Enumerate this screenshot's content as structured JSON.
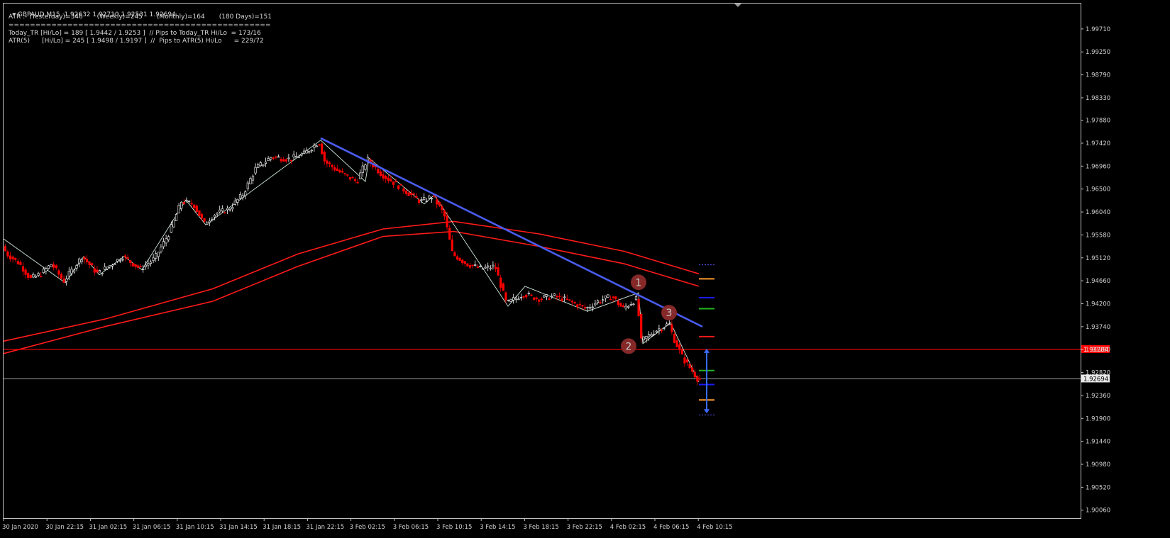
{
  "window": {
    "symbol_line": "GBPAUD,M15  1.92632 1.92710 1.92531 1.92694"
  },
  "indicator_text": {
    "atr_line": "ATR :- (Yesterday)=346       (Weekly)=245       (Monthly)=164       (180 Days)=151",
    "separator": "=================================================",
    "today_tr_line": "Today_TR [Hi/Lo] = 189 [ 1.9442 / 1.9253 ]  // Pips to Today_TR Hi/Lo  = 173/16",
    "atr5_line": "ATR(5)      [Hi/Lo] = 245 [ 1.9498 / 1.9197 ]  //  Pips to ATR(5) Hi/Lo      = 229/72"
  },
  "colors": {
    "background": "#000000",
    "axis": "#c0c0c0",
    "bull_candle": "#ffffff",
    "bear_candle": "#ff0000",
    "moving_average": "#ff1a1a",
    "trendline": "#4a5cf0",
    "support_line": "#ff0000",
    "current_price_line": "#a0a0a0",
    "zigzag": "#cfe8d8",
    "marker": "#8b2a2a"
  },
  "chart_data": {
    "type": "candlestick",
    "symbol": "GBPAUD",
    "timeframe": "M15",
    "y_ticks": [
      "1.99710",
      "1.99250",
      "1.98790",
      "1.98330",
      "1.97880",
      "1.97420",
      "1.96960",
      "1.96500",
      "1.96040",
      "1.95580",
      "1.95120",
      "1.94660",
      "1.94200",
      "1.93740",
      "1.93280",
      "1.92820",
      "1.92360",
      "1.91900",
      "1.91440",
      "1.90980",
      "1.90520",
      "1.90060"
    ],
    "ylim": [
      1.899,
      2.0022
    ],
    "x_ticks": [
      "30 Jan 2020",
      "30 Jan 22:15",
      "31 Jan 02:15",
      "31 Jan 06:15",
      "31 Jan 10:15",
      "31 Jan 14:15",
      "31 Jan 18:15",
      "31 Jan 22:15",
      "3 Feb 02:15",
      "3 Feb 06:15",
      "3 Feb 10:15",
      "3 Feb 14:15",
      "3 Feb 18:15",
      "3 Feb 22:15",
      "4 Feb 02:15",
      "4 Feb 06:15",
      "4 Feb 10:15"
    ],
    "price_path": [
      [
        0,
        1.955
      ],
      [
        12,
        1.952
      ],
      [
        30,
        1.95
      ],
      [
        45,
        1.947
      ],
      [
        60,
        1.948
      ],
      [
        75,
        1.95
      ],
      [
        92,
        1.9465
      ],
      [
        100,
        1.948
      ],
      [
        118,
        1.9515
      ],
      [
        140,
        1.948
      ],
      [
        160,
        1.95
      ],
      [
        175,
        1.9515
      ],
      [
        200,
        1.949
      ],
      [
        220,
        1.951
      ],
      [
        240,
        1.956
      ],
      [
        258,
        1.9625
      ],
      [
        275,
        1.962
      ],
      [
        290,
        1.958
      ],
      [
        305,
        1.96
      ],
      [
        325,
        1.961
      ],
      [
        345,
        1.964
      ],
      [
        362,
        1.969
      ],
      [
        385,
        1.9715
      ],
      [
        410,
        1.971
      ],
      [
        430,
        1.972
      ],
      [
        452,
        1.9745
      ],
      [
        460,
        1.9705
      ],
      [
        485,
        1.968
      ],
      [
        505,
        1.9665
      ],
      [
        520,
        1.971
      ],
      [
        540,
        1.968
      ],
      [
        560,
        1.966
      ],
      [
        580,
        1.964
      ],
      [
        595,
        1.9625
      ],
      [
        612,
        1.9635
      ],
      [
        628,
        1.96
      ],
      [
        640,
        1.952
      ],
      [
        660,
        1.95
      ],
      [
        680,
        1.949
      ],
      [
        700,
        1.9495
      ],
      [
        716,
        1.942
      ],
      [
        740,
        1.944
      ],
      [
        760,
        1.943
      ],
      [
        785,
        1.9435
      ],
      [
        805,
        1.9425
      ],
      [
        828,
        1.941
      ],
      [
        845,
        1.9425
      ],
      [
        865,
        1.9435
      ],
      [
        880,
        1.941
      ],
      [
        900,
        1.943
      ],
      [
        906,
        1.9345
      ],
      [
        925,
        1.9365
      ],
      [
        945,
        1.938
      ],
      [
        952,
        1.935
      ],
      [
        965,
        1.931
      ],
      [
        978,
        1.9285
      ],
      [
        985,
        1.927
      ]
    ],
    "moving_averages": [
      {
        "name": "",
        "points": [
          [
            5,
            1.9345
          ],
          [
            150,
            1.939
          ],
          [
            300,
            1.945
          ],
          [
            420,
            1.952
          ],
          [
            540,
            1.957
          ],
          [
            640,
            1.9585
          ],
          [
            760,
            1.956
          ],
          [
            880,
            1.9525
          ],
          [
            985,
            1.948
          ]
        ]
      },
      {
        "name": "",
        "points": [
          [
            5,
            1.932
          ],
          [
            150,
            1.9375
          ],
          [
            300,
            1.9425
          ],
          [
            420,
            1.9495
          ],
          [
            540,
            1.9555
          ],
          [
            640,
            1.9565
          ],
          [
            760,
            1.9535
          ],
          [
            880,
            1.95
          ],
          [
            985,
            1.9455
          ]
        ]
      }
    ],
    "zigzag": [
      [
        5,
        1.955
      ],
      [
        92,
        1.9462
      ],
      [
        118,
        1.9515
      ],
      [
        140,
        1.9478
      ],
      [
        175,
        1.9515
      ],
      [
        200,
        1.9488
      ],
      [
        262,
        1.9628
      ],
      [
        290,
        1.9578
      ],
      [
        452,
        1.9748
      ],
      [
        515,
        1.9665
      ],
      [
        520,
        1.9712
      ],
      [
        598,
        1.962
      ],
      [
        612,
        1.9638
      ],
      [
        716,
        1.9415
      ],
      [
        740,
        1.9455
      ],
      [
        828,
        1.9405
      ],
      [
        900,
        1.9442
      ],
      [
        906,
        1.934
      ],
      [
        945,
        1.9382
      ],
      [
        985,
        1.9263
      ]
    ],
    "trendline": {
      "from": [
        452,
        1.9752
      ],
      "to": [
        990,
        1.9374
      ]
    },
    "support_level": {
      "value": 1.93284,
      "label": "1.93284"
    },
    "current_price": {
      "value": 1.92694,
      "label": "1.92694"
    },
    "markers": [
      {
        "label": "1",
        "x": 900,
        "y": 1.9463
      },
      {
        "label": "2",
        "x": 886,
        "y": 1.9335
      },
      {
        "label": "3",
        "x": 943,
        "y": 1.9402
      }
    ],
    "atr_band": {
      "x": 996,
      "levels": [
        {
          "value": 1.9498,
          "color": "#5a5aff",
          "style": "dotted"
        },
        {
          "value": 1.947,
          "color": "#ff9a2e",
          "style": "solid"
        },
        {
          "value": 1.9432,
          "color": "#1a1aff",
          "style": "solid"
        },
        {
          "value": 1.941,
          "color": "#22b422",
          "style": "solid"
        },
        {
          "value": 1.9354,
          "color": "#ff1a1a",
          "style": "solid"
        },
        {
          "value": 1.9286,
          "color": "#22b422",
          "style": "solid"
        },
        {
          "value": 1.9258,
          "color": "#1a1aff",
          "style": "solid"
        },
        {
          "value": 1.9227,
          "color": "#ff9a2e",
          "style": "solid"
        },
        {
          "value": 1.9197,
          "color": "#5a5aff",
          "style": "dotted"
        }
      ],
      "arrow_from": 1.933,
      "arrow_to": 1.92
    }
  }
}
